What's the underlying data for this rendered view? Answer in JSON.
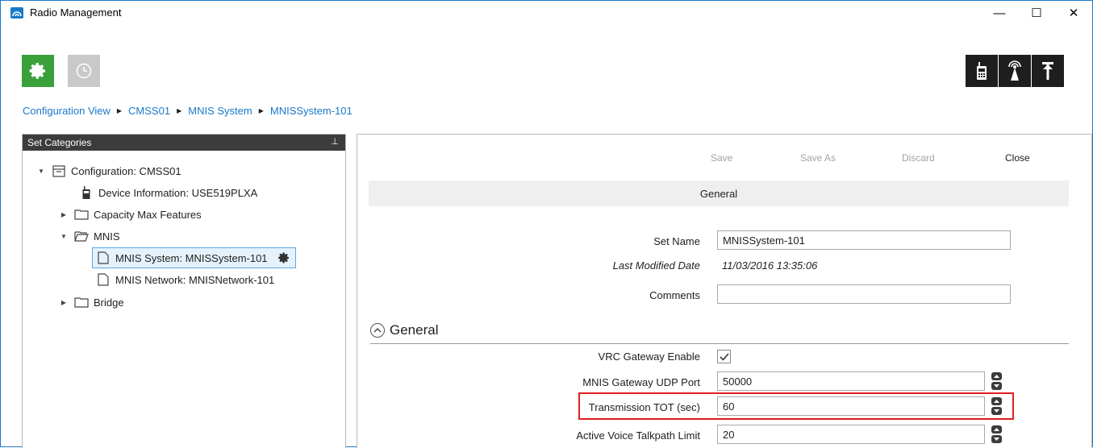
{
  "window": {
    "title": "Radio Management",
    "minimize_glyph": "—",
    "maximize_glyph": "☐",
    "close_glyph": "✕"
  },
  "toolbar": {
    "left_buttons": [
      "gear-icon",
      "clock-icon"
    ],
    "right_buttons": [
      "radio-device-icon",
      "antenna-icon",
      "upload-icon"
    ],
    "settings_color": "#3aa13a"
  },
  "breadcrumb": [
    "Configuration View",
    "CMSS01",
    "MNIS System",
    "MNISSystem-101"
  ],
  "left_panel": {
    "header": "Set Categories",
    "pin_glyph": "📌",
    "tree": [
      {
        "label": "Configuration: CMSS01",
        "icon": "archive-icon",
        "expanded": true
      },
      {
        "label": "Device Information: USE519PLXA",
        "icon": "radio-device-icon"
      },
      {
        "label": "Capacity Max Features",
        "icon": "folder-icon",
        "expanded": false
      },
      {
        "label": "MNIS",
        "icon": "folder-open-icon",
        "expanded": true
      },
      {
        "label": "MNIS System: MNISSystem-101",
        "icon": "document-icon",
        "selected": true
      },
      {
        "label": "MNIS Network: MNISNetwork-101",
        "icon": "document-icon"
      },
      {
        "label": "Bridge",
        "icon": "folder-icon",
        "expanded": false
      }
    ]
  },
  "actions": {
    "save": "Save",
    "save_as": "Save As",
    "discard": "Discard",
    "close": "Close"
  },
  "section_title": "General",
  "form": {
    "set_name_label": "Set Name",
    "set_name_value": "MNISSystem-101",
    "last_modified_label": "Last Modified Date",
    "last_modified_value": "11/03/2016 13:35:06",
    "comments_label": "Comments",
    "comments_value": ""
  },
  "general_group": {
    "title": "General",
    "vrc_label": "VRC Gateway Enable",
    "vrc_checked": true,
    "udp_label": "MNIS Gateway UDP Port",
    "udp_value": "50000",
    "tot_label": "Transmission TOT (sec)",
    "tot_value": "60",
    "talkpath_label": "Active Voice Talkpath Limit",
    "talkpath_value": "20"
  },
  "colors": {
    "accent": "#1979ca",
    "highlight": "#e01f1f",
    "selection": "#e6f2fb"
  }
}
